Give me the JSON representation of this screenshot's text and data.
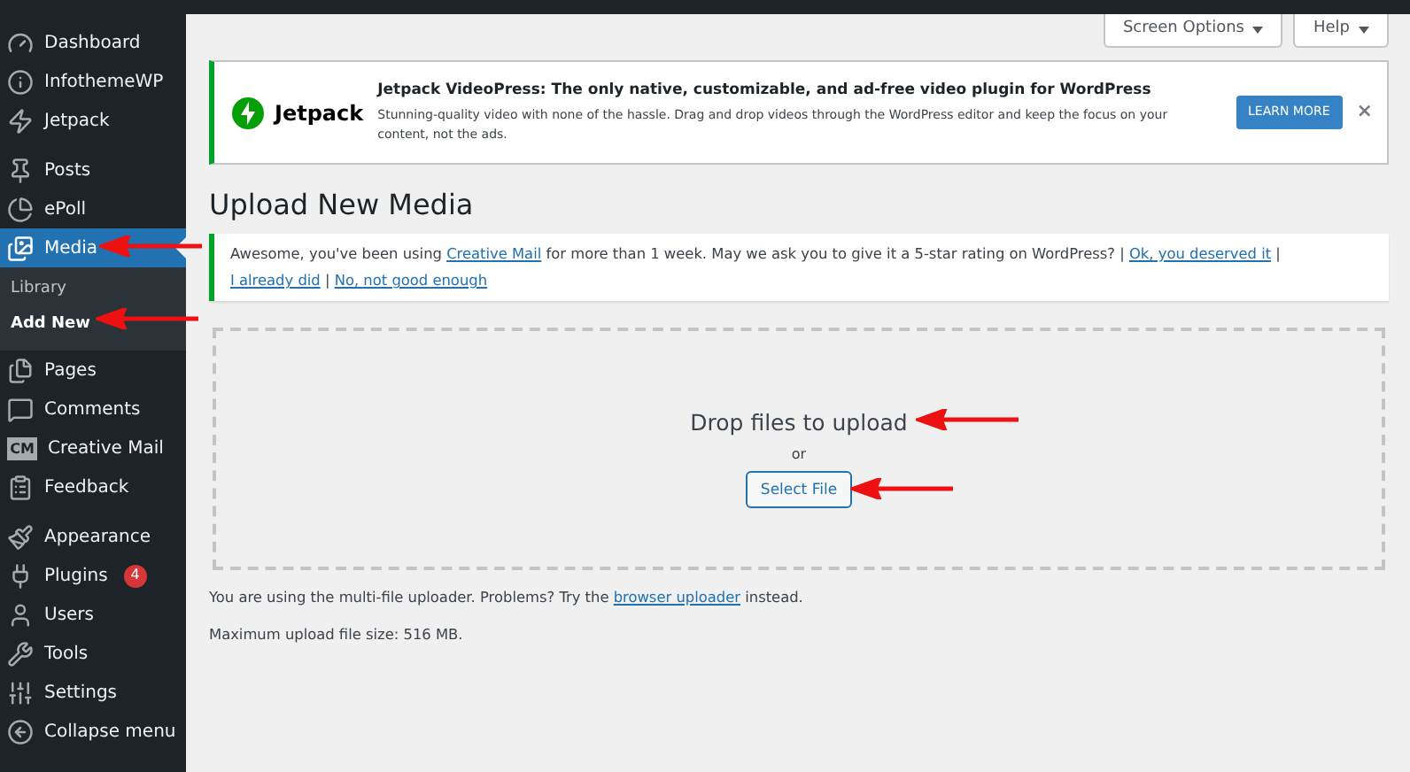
{
  "sidebar": {
    "sections": [
      {
        "items": [
          {
            "label": "Dashboard",
            "selected": false
          },
          {
            "label": "InfothemeWP",
            "selected": false
          },
          {
            "label": "Jetpack",
            "selected": false
          }
        ]
      },
      {
        "items": [
          {
            "label": "Posts",
            "selected": false
          },
          {
            "label": "ePoll",
            "selected": false
          },
          {
            "label": "Media",
            "selected": true,
            "children": [
              {
                "label": "Library",
                "selected": false
              },
              {
                "label": "Add New",
                "selected": true
              }
            ]
          },
          {
            "label": "Pages",
            "selected": false
          },
          {
            "label": "Comments",
            "selected": false
          },
          {
            "label": "Creative Mail",
            "icon_text": "CM",
            "selected": false
          },
          {
            "label": "Feedback",
            "selected": false
          }
        ]
      },
      {
        "items": [
          {
            "label": "Appearance",
            "selected": false
          },
          {
            "label": "Plugins",
            "badge": "4",
            "selected": false
          },
          {
            "label": "Users",
            "selected": false
          },
          {
            "label": "Tools",
            "selected": false
          },
          {
            "label": "Settings",
            "selected": false
          },
          {
            "label": "Collapse menu",
            "selected": false
          }
        ]
      }
    ]
  },
  "top_buttons": [
    "Screen Options",
    "Help"
  ],
  "jetpack_notice": {
    "logo_text": "Jetpack",
    "title": "Jetpack VideoPress: The only native, customizable, and ad-free video plugin for WordPress",
    "body": "Stunning-quality video with none of the hassle. Drag and drop videos through the WordPress editor and keep the focus on your content, not the ads.",
    "button": "LEARN MORE",
    "close": "×"
  },
  "heading": "Upload New Media",
  "rating_notice": [
    {
      "text": "Awesome, you've been using ",
      "link": false
    },
    {
      "text": "Creative Mail",
      "link": true
    },
    {
      "text": " for more than 1 week. May we ask you to give it a 5-star rating on WordPress? | ",
      "link": false
    },
    {
      "text": "Ok, you deserved it",
      "link": true
    },
    {
      "text": " | ",
      "link": false
    },
    {
      "text": "I already did",
      "link": true
    },
    {
      "text": " | ",
      "link": false
    },
    {
      "text": "No, not good enough",
      "link": true
    }
  ],
  "dropzone": {
    "title": "Drop files to upload",
    "or": "or",
    "button": "Select File"
  },
  "uploader_note": [
    {
      "text": "You are using the multi-file uploader. Problems? Try the ",
      "link": false
    },
    {
      "text": "browser uploader",
      "link": true
    },
    {
      "text": " instead.",
      "link": false
    }
  ],
  "max_size": "Maximum upload file size: 516 MB."
}
